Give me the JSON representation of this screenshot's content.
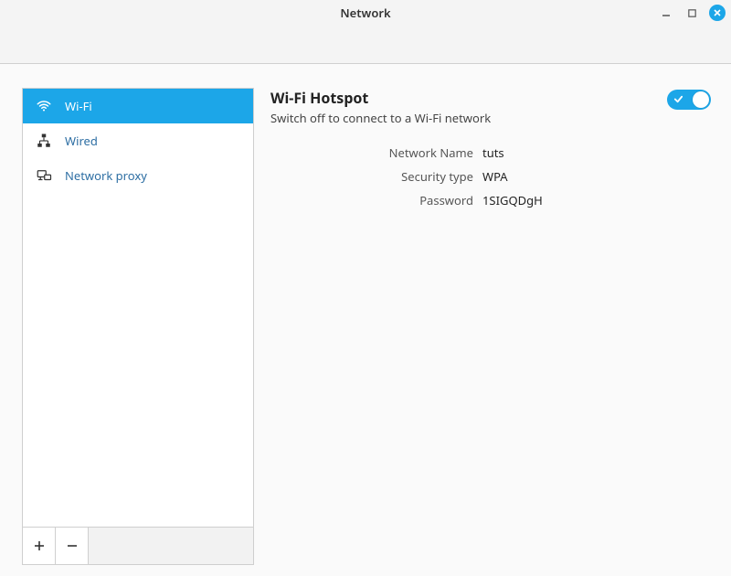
{
  "window": {
    "title": "Network"
  },
  "sidebar": {
    "items": [
      {
        "label": "Wi-Fi",
        "icon": "wifi-icon",
        "selected": true
      },
      {
        "label": "Wired",
        "icon": "wired-icon",
        "selected": false
      },
      {
        "label": "Network proxy",
        "icon": "proxy-icon",
        "selected": false
      }
    ]
  },
  "content": {
    "title": "Wi-Fi Hotspot",
    "subtitle": "Switch off to connect to a Wi-Fi network",
    "toggle_on": true,
    "details": [
      {
        "label": "Network Name",
        "value": "tuts"
      },
      {
        "label": "Security type",
        "value": "WPA"
      },
      {
        "label": "Password",
        "value": "1SIGQDgH"
      }
    ]
  }
}
